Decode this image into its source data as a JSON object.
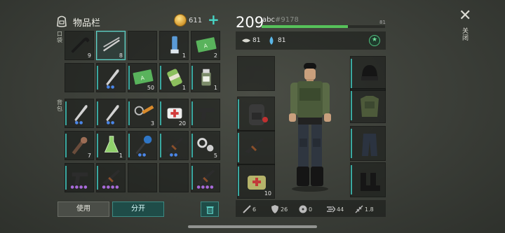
{
  "inventory": {
    "title": "物品栏",
    "coins": "611",
    "pocket_label": "口袋",
    "backpack_label": "背包",
    "slots": [
      {
        "icon": "crowbar-icon",
        "count": "9"
      },
      {
        "icon": "bolts-icon",
        "count": "8"
      },
      {
        "icon": "",
        "count": ""
      },
      {
        "icon": "inhaler-icon",
        "count": "1"
      },
      {
        "icon": "cash-icon",
        "count": "2"
      },
      {
        "icon": "",
        "count": ""
      },
      {
        "icon": "machete-icon",
        "count": ""
      },
      {
        "icon": "cash-icon",
        "count": "50"
      },
      {
        "icon": "bandage-roll-icon",
        "count": "1"
      },
      {
        "icon": "pill-bottle-icon",
        "count": "1"
      },
      {
        "icon": "machete-icon",
        "count": ""
      },
      {
        "icon": "machete-icon",
        "count": ""
      },
      {
        "icon": "rope-icon",
        "count": "3"
      },
      {
        "icon": "first-aid-icon",
        "count": "20"
      },
      {
        "icon": "pistol-icon",
        "count": ""
      },
      {
        "icon": "pipe-icon",
        "count": "7"
      },
      {
        "icon": "flask-icon",
        "count": "1"
      },
      {
        "icon": "spiked-club-icon",
        "count": ""
      },
      {
        "icon": "rifle-icon",
        "count": ""
      },
      {
        "icon": "gear-parts-icon",
        "count": "5"
      },
      {
        "icon": "pistol-icon",
        "count": ""
      },
      {
        "icon": "rifle-icon",
        "count": ""
      },
      {
        "icon": "",
        "count": ""
      },
      {
        "icon": "",
        "count": ""
      },
      {
        "icon": "rifle-icon",
        "count": ""
      }
    ],
    "use_label": "使用",
    "split_label": "分开"
  },
  "player": {
    "level": "209",
    "name": "abc",
    "id": "#9178",
    "xp_value": "81",
    "xp_fraction": 0.7,
    "hunger": "81",
    "thirst": "81"
  },
  "equipment": {
    "weapon_slots": [
      {
        "icon": "pistol-icon",
        "count": ""
      },
      {
        "icon": "backpack-icon",
        "count": ""
      },
      {
        "icon": "rifle-icon",
        "count": ""
      },
      {
        "icon": "medkit-bag-icon",
        "count": "10"
      }
    ],
    "armor_slots": [
      {
        "icon": "beanie-icon"
      },
      {
        "icon": "vest-icon"
      },
      {
        "icon": "pants-icon"
      },
      {
        "icon": "boots-icon"
      }
    ]
  },
  "combat_stats": {
    "attack": "6",
    "armor": "26",
    "radiation": "0",
    "speed": "44",
    "crit": "1.8"
  },
  "close_label": "关闭",
  "colors": {
    "accent": "#47d6c6",
    "xp_bar": "#56c25a",
    "rarity_blue": "#4a86e8",
    "rarity_purple": "#a86ad9"
  }
}
